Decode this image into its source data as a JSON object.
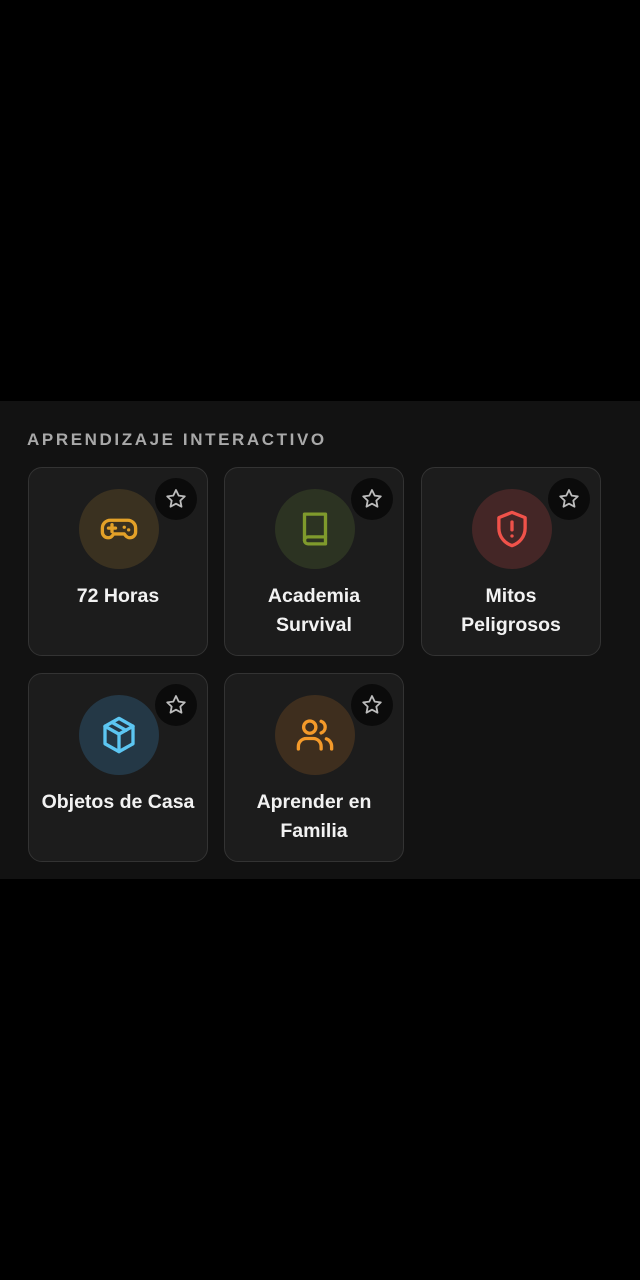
{
  "section": {
    "title": "APRENDIZAJE INTERACTIVO"
  },
  "cards": [
    {
      "label": "72 Horas",
      "icon": "gamepad-icon",
      "accent": "#e3a128",
      "icon_bg": "#3a3120"
    },
    {
      "label": "Academia Survival",
      "icon": "book-icon",
      "accent": "#7f9a2c",
      "icon_bg": "#2c3322"
    },
    {
      "label": "Mitos Peligrosos",
      "icon": "shield-alert-icon",
      "accent": "#f0524a",
      "icon_bg": "#442626"
    },
    {
      "label": "Objetos de Casa",
      "icon": "box-icon",
      "accent": "#5cc6f2",
      "icon_bg": "#243846"
    },
    {
      "label": "Aprender en Familia",
      "icon": "users-icon",
      "accent": "#f49a2a",
      "icon_bg": "#3e2e1e"
    }
  ]
}
